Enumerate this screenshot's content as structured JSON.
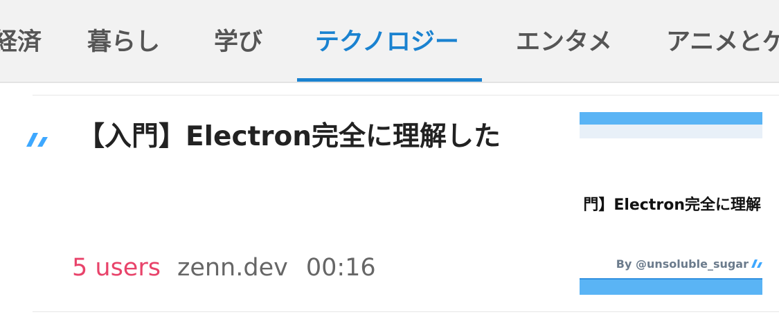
{
  "tabs": [
    {
      "label": "経済",
      "active": false
    },
    {
      "label": "暮らし",
      "active": false
    },
    {
      "label": "学び",
      "active": false
    },
    {
      "label": "テクノロジー",
      "active": true
    },
    {
      "label": "エンタメ",
      "active": false
    },
    {
      "label": "アニメとゲ",
      "active": false
    }
  ],
  "colors": {
    "accent": "#1a82d0",
    "users": "#e8436a",
    "thumb_blue": "#5ab4f5"
  },
  "entry": {
    "site_icon": "zenn-logo-icon",
    "title": "【入門】Electron完全に理解した",
    "users": "5 users",
    "domain": "zenn.dev",
    "time": "00:16",
    "thumbnail": {
      "title": "門】Electron完全に理解",
      "author": "By @unsoluble_sugar",
      "logo": "zenn-logo-icon"
    }
  }
}
